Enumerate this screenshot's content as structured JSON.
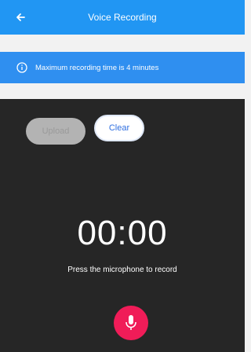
{
  "header": {
    "title": "Voice Recording",
    "back_icon": "arrow-left-icon"
  },
  "banner": {
    "icon": "info-icon",
    "message": "Maximum recording time is 4 minutes"
  },
  "actions": {
    "upload_label": "Upload",
    "clear_label": "Clear"
  },
  "recorder": {
    "timer": "00:00",
    "hint": "Press the microphone to record",
    "mic_icon": "microphone-icon"
  },
  "colors": {
    "header": "#2196f3",
    "banner": "#2f8ff0",
    "panel": "#262626",
    "mic": "#f01c58"
  }
}
